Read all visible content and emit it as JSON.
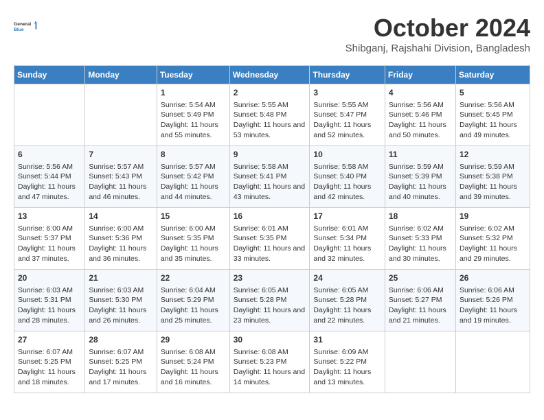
{
  "logo": {
    "line1": "General",
    "line2": "Blue"
  },
  "title": "October 2024",
  "subtitle": "Shibganj, Rajshahi Division, Bangladesh",
  "days_of_week": [
    "Sunday",
    "Monday",
    "Tuesday",
    "Wednesday",
    "Thursday",
    "Friday",
    "Saturday"
  ],
  "weeks": [
    [
      {
        "day": "",
        "info": ""
      },
      {
        "day": "",
        "info": ""
      },
      {
        "day": "1",
        "info": "Sunrise: 5:54 AM\nSunset: 5:49 PM\nDaylight: 11 hours and 55 minutes."
      },
      {
        "day": "2",
        "info": "Sunrise: 5:55 AM\nSunset: 5:48 PM\nDaylight: 11 hours and 53 minutes."
      },
      {
        "day": "3",
        "info": "Sunrise: 5:55 AM\nSunset: 5:47 PM\nDaylight: 11 hours and 52 minutes."
      },
      {
        "day": "4",
        "info": "Sunrise: 5:56 AM\nSunset: 5:46 PM\nDaylight: 11 hours and 50 minutes."
      },
      {
        "day": "5",
        "info": "Sunrise: 5:56 AM\nSunset: 5:45 PM\nDaylight: 11 hours and 49 minutes."
      }
    ],
    [
      {
        "day": "6",
        "info": "Sunrise: 5:56 AM\nSunset: 5:44 PM\nDaylight: 11 hours and 47 minutes."
      },
      {
        "day": "7",
        "info": "Sunrise: 5:57 AM\nSunset: 5:43 PM\nDaylight: 11 hours and 46 minutes."
      },
      {
        "day": "8",
        "info": "Sunrise: 5:57 AM\nSunset: 5:42 PM\nDaylight: 11 hours and 44 minutes."
      },
      {
        "day": "9",
        "info": "Sunrise: 5:58 AM\nSunset: 5:41 PM\nDaylight: 11 hours and 43 minutes."
      },
      {
        "day": "10",
        "info": "Sunrise: 5:58 AM\nSunset: 5:40 PM\nDaylight: 11 hours and 42 minutes."
      },
      {
        "day": "11",
        "info": "Sunrise: 5:59 AM\nSunset: 5:39 PM\nDaylight: 11 hours and 40 minutes."
      },
      {
        "day": "12",
        "info": "Sunrise: 5:59 AM\nSunset: 5:38 PM\nDaylight: 11 hours and 39 minutes."
      }
    ],
    [
      {
        "day": "13",
        "info": "Sunrise: 6:00 AM\nSunset: 5:37 PM\nDaylight: 11 hours and 37 minutes."
      },
      {
        "day": "14",
        "info": "Sunrise: 6:00 AM\nSunset: 5:36 PM\nDaylight: 11 hours and 36 minutes."
      },
      {
        "day": "15",
        "info": "Sunrise: 6:00 AM\nSunset: 5:35 PM\nDaylight: 11 hours and 35 minutes."
      },
      {
        "day": "16",
        "info": "Sunrise: 6:01 AM\nSunset: 5:35 PM\nDaylight: 11 hours and 33 minutes."
      },
      {
        "day": "17",
        "info": "Sunrise: 6:01 AM\nSunset: 5:34 PM\nDaylight: 11 hours and 32 minutes."
      },
      {
        "day": "18",
        "info": "Sunrise: 6:02 AM\nSunset: 5:33 PM\nDaylight: 11 hours and 30 minutes."
      },
      {
        "day": "19",
        "info": "Sunrise: 6:02 AM\nSunset: 5:32 PM\nDaylight: 11 hours and 29 minutes."
      }
    ],
    [
      {
        "day": "20",
        "info": "Sunrise: 6:03 AM\nSunset: 5:31 PM\nDaylight: 11 hours and 28 minutes."
      },
      {
        "day": "21",
        "info": "Sunrise: 6:03 AM\nSunset: 5:30 PM\nDaylight: 11 hours and 26 minutes."
      },
      {
        "day": "22",
        "info": "Sunrise: 6:04 AM\nSunset: 5:29 PM\nDaylight: 11 hours and 25 minutes."
      },
      {
        "day": "23",
        "info": "Sunrise: 6:05 AM\nSunset: 5:28 PM\nDaylight: 11 hours and 23 minutes."
      },
      {
        "day": "24",
        "info": "Sunrise: 6:05 AM\nSunset: 5:28 PM\nDaylight: 11 hours and 22 minutes."
      },
      {
        "day": "25",
        "info": "Sunrise: 6:06 AM\nSunset: 5:27 PM\nDaylight: 11 hours and 21 minutes."
      },
      {
        "day": "26",
        "info": "Sunrise: 6:06 AM\nSunset: 5:26 PM\nDaylight: 11 hours and 19 minutes."
      }
    ],
    [
      {
        "day": "27",
        "info": "Sunrise: 6:07 AM\nSunset: 5:25 PM\nDaylight: 11 hours and 18 minutes."
      },
      {
        "day": "28",
        "info": "Sunrise: 6:07 AM\nSunset: 5:25 PM\nDaylight: 11 hours and 17 minutes."
      },
      {
        "day": "29",
        "info": "Sunrise: 6:08 AM\nSunset: 5:24 PM\nDaylight: 11 hours and 16 minutes."
      },
      {
        "day": "30",
        "info": "Sunrise: 6:08 AM\nSunset: 5:23 PM\nDaylight: 11 hours and 14 minutes."
      },
      {
        "day": "31",
        "info": "Sunrise: 6:09 AM\nSunset: 5:22 PM\nDaylight: 11 hours and 13 minutes."
      },
      {
        "day": "",
        "info": ""
      },
      {
        "day": "",
        "info": ""
      }
    ]
  ]
}
